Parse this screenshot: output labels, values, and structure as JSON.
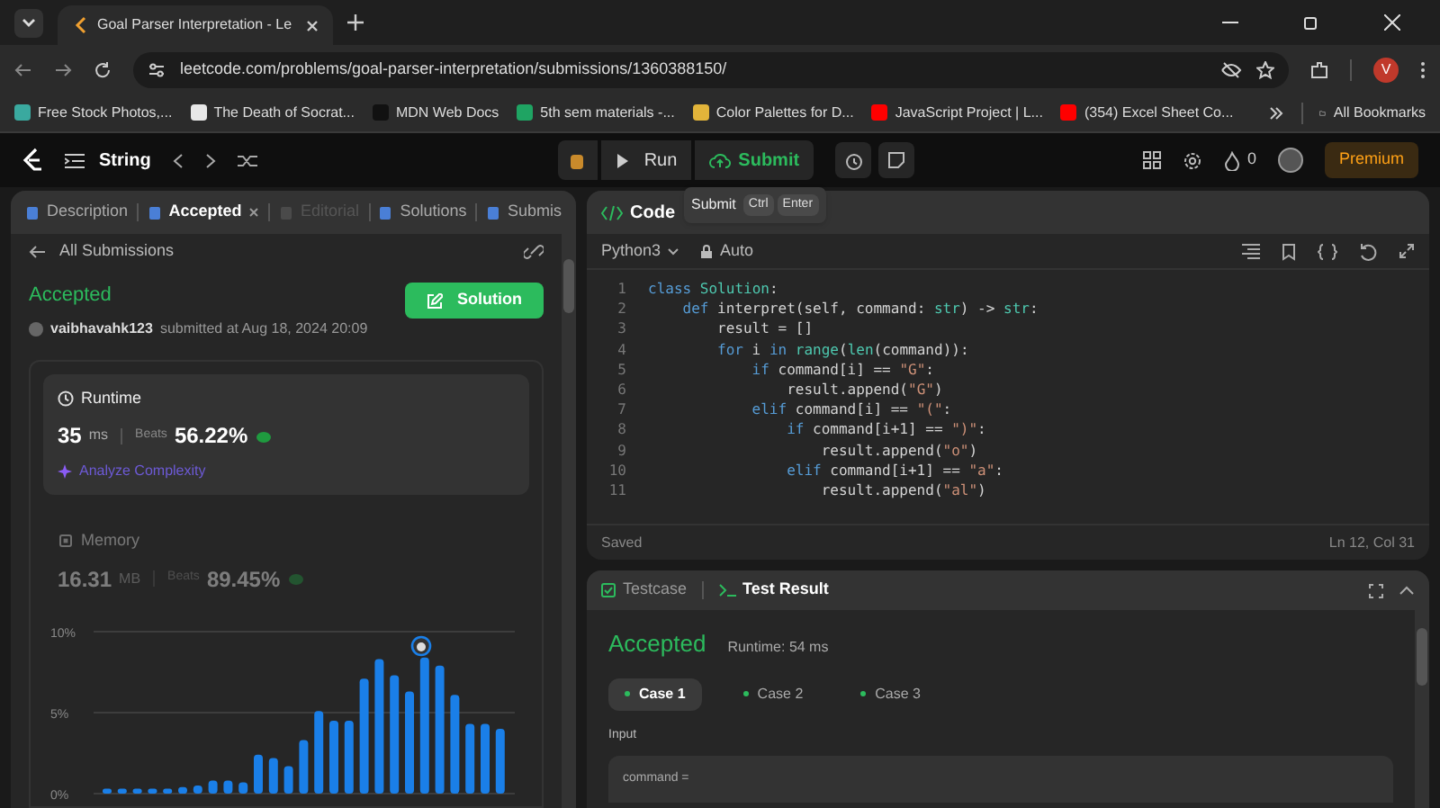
{
  "browser": {
    "tab_title": "Goal Parser Interpretation - Le",
    "url": "leetcode.com/problems/goal-parser-interpretation/submissions/1360388150/",
    "profile_initial": "V",
    "all_bookmarks": "All Bookmarks",
    "bookmarks": [
      {
        "label": "Free Stock Photos,...",
        "color": "#3aa99f"
      },
      {
        "label": "The Death of Socrat...",
        "color": "#e8e8e8"
      },
      {
        "label": "MDN Web Docs",
        "color": "#111111"
      },
      {
        "label": "5th sem materials -...",
        "color": "#1fa463"
      },
      {
        "label": "Color Palettes for D...",
        "color": "#e2b43a"
      },
      {
        "label": "JavaScript Project | L...",
        "color": "#ff0000"
      },
      {
        "label": "(354) Excel Sheet Co...",
        "color": "#ff0000"
      }
    ]
  },
  "topbar": {
    "problem_list": "String",
    "run": "Run",
    "submit": "Submit",
    "streak": "0",
    "premium": "Premium"
  },
  "tooltip": {
    "label": "Submit",
    "keys": [
      "Ctrl",
      "Enter"
    ]
  },
  "left_tabs": [
    {
      "label": "Description",
      "selected": false,
      "disabled": false
    },
    {
      "label": "Accepted",
      "selected": true,
      "disabled": false
    },
    {
      "label": "Editorial",
      "selected": false,
      "disabled": true
    },
    {
      "label": "Solutions",
      "selected": false,
      "disabled": false
    },
    {
      "label": "Submis",
      "selected": false,
      "disabled": false
    }
  ],
  "back_link": "All Submissions",
  "submission": {
    "status": "Accepted",
    "user": "vaibhavahk123",
    "submitted": "submitted at Aug 18, 2024 20:09",
    "solution_button": "Solution"
  },
  "metrics": [
    {
      "title": "Runtime",
      "value": "35",
      "unit": "ms",
      "beats_label": "Beats",
      "beats": "56.22%",
      "link": "Analyze Complexity",
      "selected": true
    },
    {
      "title": "Memory",
      "value": "16.31",
      "unit": "MB",
      "beats_label": "Beats",
      "beats": "89.45%",
      "selected": false
    }
  ],
  "chart_data": {
    "type": "bar",
    "ylim": [
      0,
      10
    ],
    "yticks": [
      {
        "value": 0,
        "label": "0%"
      },
      {
        "value": 5,
        "label": "5%"
      },
      {
        "value": 10,
        "label": "10%"
      }
    ],
    "values": [
      0.3,
      0.3,
      0.3,
      0.3,
      0.3,
      0.4,
      0.5,
      0.8,
      0.8,
      0.7,
      2.4,
      2.2,
      1.7,
      3.3,
      5.1,
      4.5,
      4.5,
      7.1,
      8.3,
      7.3,
      6.3,
      8.4,
      7.9,
      6.1,
      4.3,
      4.3,
      4.0
    ]
  },
  "editor": {
    "tab": "Code",
    "language": "Python3",
    "mode": "Auto",
    "status": "Saved",
    "cursor": "Ln 12, Col 31",
    "lines": [
      {
        "number": "1",
        "text": "class Solution:"
      },
      {
        "number": "2",
        "text": "    def interpret(self, command: str) -> str:"
      },
      {
        "number": "3",
        "text": "        result = []"
      },
      {
        "number": "4",
        "text": "        for i in range(len(command)):"
      },
      {
        "number": "5",
        "text": "            if command[i] == \"G\":"
      },
      {
        "number": "6",
        "text": "                result.append(\"G\")"
      },
      {
        "number": "7",
        "text": "            elif command[i] == \"(\":"
      },
      {
        "number": "8",
        "text": "                if command[i+1] == \")\":"
      },
      {
        "number": "9",
        "text": "                    result.append(\"o\")"
      },
      {
        "number": "10",
        "text": "                elif command[i+1] == \"a\":"
      },
      {
        "number": "11",
        "text": "                    result.append(\"al\")"
      }
    ]
  },
  "test_tabs": [
    {
      "label": "Testcase",
      "selected": false
    },
    {
      "label": "Test Result",
      "selected": true
    }
  ],
  "result": {
    "status": "Accepted",
    "runtime": "Runtime: 54 ms",
    "input_label": "Input",
    "input": "command =",
    "cases": [
      {
        "label": "Case 1",
        "selected": true
      },
      {
        "label": "Case 2",
        "selected": false
      },
      {
        "label": "Case 3",
        "selected": false
      }
    ]
  }
}
